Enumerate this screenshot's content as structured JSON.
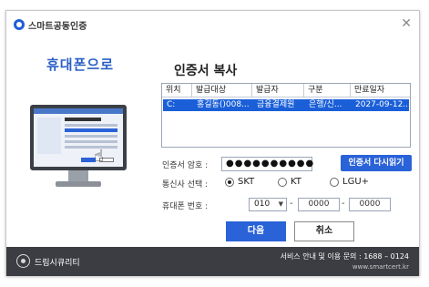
{
  "app": {
    "title": "스마트공동인증"
  },
  "left_title": "휴대폰으로",
  "main": {
    "title": "인증서 복사",
    "table": {
      "headers": [
        "위치",
        "발급대상",
        "발급자",
        "구분",
        "만료일자"
      ],
      "rows": [
        [
          "C:",
          "홍길동()008...",
          "금융결제원",
          "은행/신...",
          "2027-09-12..."
        ]
      ]
    },
    "password": {
      "label": "인증서 암호 :",
      "value": "●●●●●●●●●●"
    },
    "reread_button": "인증서 다시읽기",
    "carrier": {
      "label": "통신사 선택 :",
      "options": [
        "SKT",
        "KT",
        "LGU+"
      ],
      "selected": "SKT"
    },
    "phone": {
      "label": "휴대폰 번호 :",
      "prefix": "010",
      "middle": "0000",
      "last": "0000",
      "separator": "-"
    },
    "next_button": "다음",
    "cancel_button": "취소"
  },
  "footer": {
    "brand": "드림시큐리티",
    "info": "서비스 안내 및 이용 문의 : 1688 – 0124",
    "url": "www.smartcert.kr"
  },
  "colors": {
    "accent": "#2a62d8",
    "footer_bg": "#3b3d42",
    "selection": "#1a5fd8"
  }
}
